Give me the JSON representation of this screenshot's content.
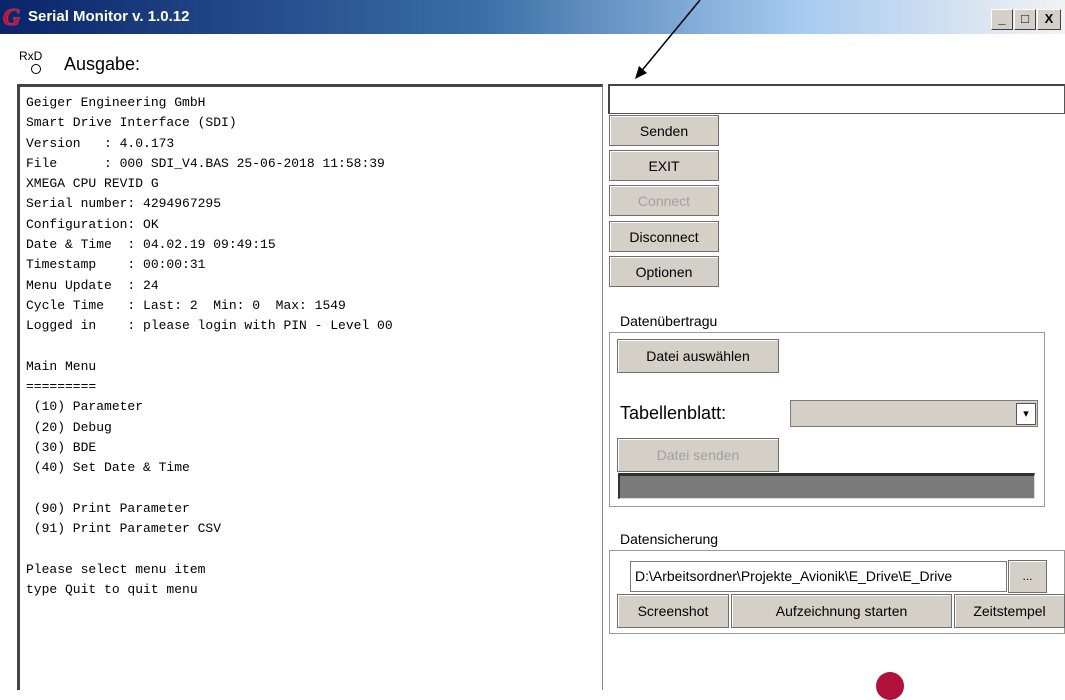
{
  "window": {
    "logo_letter": "G",
    "title": "Serial Monitor v. 1.0.12",
    "controls": {
      "minimize": "_",
      "maximize": "□",
      "close": "X"
    }
  },
  "rxd": {
    "label": "RxD"
  },
  "output": {
    "label": "Ausgabe:",
    "text": "Geiger Engineering GmbH\nSmart Drive Interface (SDI)\nVersion   : 4.0.173\nFile      : 000 SDI_V4.BAS 25-06-2018 11:58:39\nXMEGA CPU REVID G\nSerial number: 4294967295\nConfiguration: OK\nDate & Time  : 04.02.19 09:49:15\nTimestamp    : 00:00:31\nMenu Update  : 24\nCycle Time   : Last: 2  Min: 0  Max: 1549\nLogged in    : please login with PIN - Level 00\n\nMain Menu\n=========\n (10) Parameter\n (20) Debug\n (30) BDE\n (40) Set Date & Time\n\n (90) Print Parameter\n (91) Print Parameter CSV\n\nPlease select menu item\ntype Quit to quit menu"
  },
  "send": {
    "input_value": ""
  },
  "buttons": {
    "senden": "Senden",
    "exit": "EXIT",
    "connect": "Connect",
    "disconnect": "Disconnect",
    "optionen": "Optionen"
  },
  "datenuebertragung": {
    "label": "Datenübertragu",
    "datei_auswaehlen": "Datei auswählen",
    "tabellenblatt_label": "Tabellenblatt:",
    "tabellenblatt_value": "",
    "datei_senden": "Datei senden",
    "progress": 0
  },
  "datensicherung": {
    "label": "Datensicherung",
    "path": "D:\\Arbeitsordner\\Projekte_Avionik\\E_Drive\\E_Drive",
    "browse": "...",
    "screenshot": "Screenshot",
    "aufzeichnung": "Aufzeichnung starten",
    "zeitstempel": "Zeitstempel"
  },
  "colors": {
    "title_gradient_start": "#0a246a",
    "button_face": "#d4d0c8",
    "logo_red": "#e8001c"
  }
}
